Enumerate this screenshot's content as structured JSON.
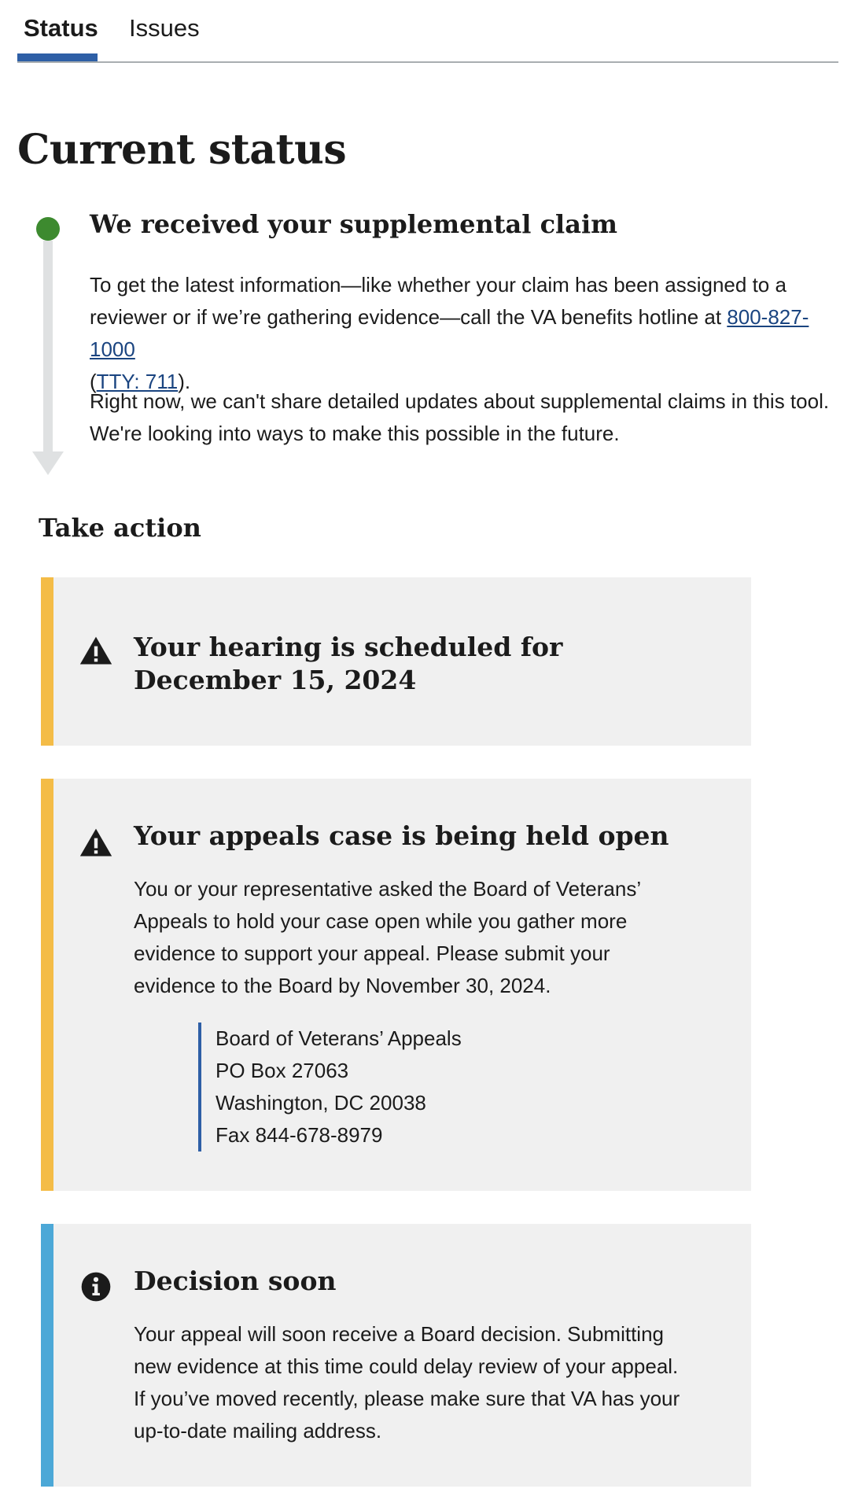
{
  "tabs": [
    {
      "label": "Status",
      "active": true
    },
    {
      "label": "Issues",
      "active": false
    }
  ],
  "page_title": "Current status",
  "status_step": {
    "heading": "We received your supplemental claim",
    "para1_text": "To get the latest information—like whether your claim has been assigned to a reviewer or if we’re gathering evidence—call the VA benefits hotline at ",
    "phone": "800-827-1000",
    "tty_open": "(",
    "tty": "TTY: 711",
    "tty_close": ").",
    "para2": "Right now, we can't share detailed updates about supplemental claims in this tool. We're looking into ways to make this possible in the future.",
    "dot_color": "#3d8a2f"
  },
  "take_action": "Take action",
  "alerts": [
    {
      "type": "warning",
      "icon": "warning-icon",
      "title": "Your hearing is scheduled for December 15, 2024"
    },
    {
      "type": "warning",
      "icon": "warning-icon",
      "title": "Your appeals case is being held open",
      "body": "You or your representative asked the Board of Veterans’ Appeals to hold your case open while you gather more evidence to support your appeal. Please submit your evidence to the Board by November 30, 2024.",
      "address": [
        "Board of Veterans’ Appeals",
        "PO Box 27063",
        "Washington, DC 20038",
        "Fax 844-678-8979"
      ]
    },
    {
      "type": "info",
      "icon": "info-icon",
      "title": "Decision soon",
      "body": "Your appeal will soon receive a Board decision. Submitting new evidence at this time could delay review of your appeal. If you’ve moved recently, please make sure that VA has your up-to-date mailing address."
    }
  ],
  "colors": {
    "warning": "#f4bc47",
    "info": "#4ca8d7",
    "link": "#1a4480",
    "tab_underline": "#2e5fa6"
  }
}
